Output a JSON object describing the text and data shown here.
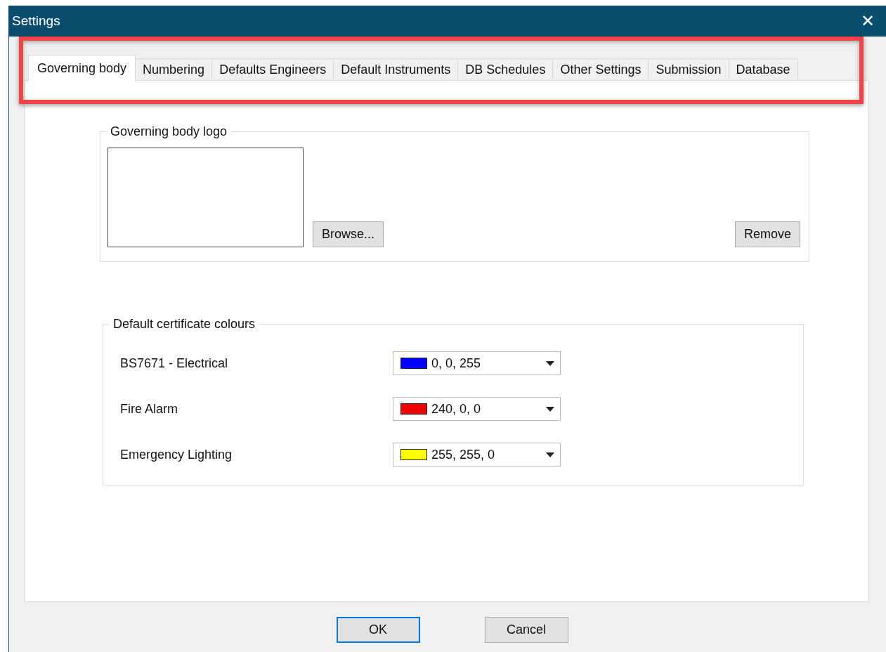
{
  "window": {
    "title": "Settings",
    "close": "✕"
  },
  "tabs": [
    {
      "label": "Governing body",
      "selected": true
    },
    {
      "label": "Numbering",
      "selected": false
    },
    {
      "label": "Defaults Engineers",
      "selected": false
    },
    {
      "label": "Default Instruments",
      "selected": false
    },
    {
      "label": "DB Schedules",
      "selected": false
    },
    {
      "label": "Other Settings",
      "selected": false
    },
    {
      "label": "Submission",
      "selected": false
    },
    {
      "label": "Database",
      "selected": false
    }
  ],
  "logo_group": {
    "title": "Governing body logo",
    "browse": "Browse...",
    "remove": "Remove"
  },
  "colours_group": {
    "title": "Default certificate colours",
    "rows": [
      {
        "label": "BS7671 - Electrical",
        "value": "0, 0, 255",
        "color": "#0000ff"
      },
      {
        "label": "Fire Alarm",
        "value": "240, 0, 0",
        "color": "#f00000"
      },
      {
        "label": "Emergency Lighting",
        "value": "255, 255, 0",
        "color": "#ffff00"
      }
    ]
  },
  "buttons": [
    {
      "label": "OK",
      "default": true
    },
    {
      "label": "Cancel",
      "default": false
    }
  ]
}
